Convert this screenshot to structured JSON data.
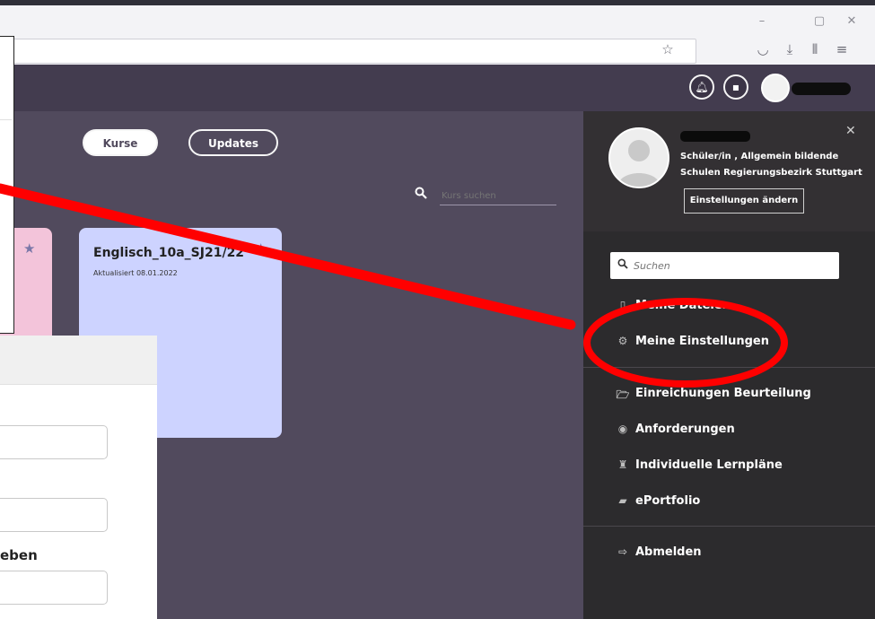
{
  "browser": {
    "window_controls": [
      "–",
      "▢",
      "✕"
    ],
    "toolbar_icons": [
      "bookmark-star-icon",
      "pocket-icon",
      "download-icon",
      "library-icon",
      "menu-icon"
    ]
  },
  "header": {
    "icons": [
      "bell-icon",
      "chat-icon"
    ]
  },
  "main": {
    "buttons": {
      "courses": "Kurse",
      "updates": "Updates"
    },
    "search": {
      "placeholder": "Kurs suchen"
    },
    "course_card": {
      "title": "Englisch_10a_SJ21/22",
      "updated": "Aktualisiert 08.01.2022"
    }
  },
  "overlay_form": {
    "field_label": "eben"
  },
  "panel": {
    "role": "Schüler/in , Allgemein bildende Schulen Regierungsbezirk Stuttgart",
    "settings_button": "Einstellungen ändern",
    "search_placeholder": "Suchen",
    "nav": [
      {
        "label": "Meine Dateien",
        "icon": "file-icon"
      },
      {
        "label": "Meine Einstellungen",
        "icon": "gear-icon"
      },
      {
        "label": "Einreichungen Beurteilung",
        "icon": "folder-icon"
      },
      {
        "label": "Anforderungen",
        "icon": "target-icon"
      },
      {
        "label": "Individuelle Lernpläne",
        "icon": "person-icon"
      },
      {
        "label": "ePortfolio",
        "icon": "book-icon"
      },
      {
        "label": "Abmelden",
        "icon": "logout-icon"
      }
    ]
  },
  "annotation": {
    "color": "#ff0000"
  }
}
